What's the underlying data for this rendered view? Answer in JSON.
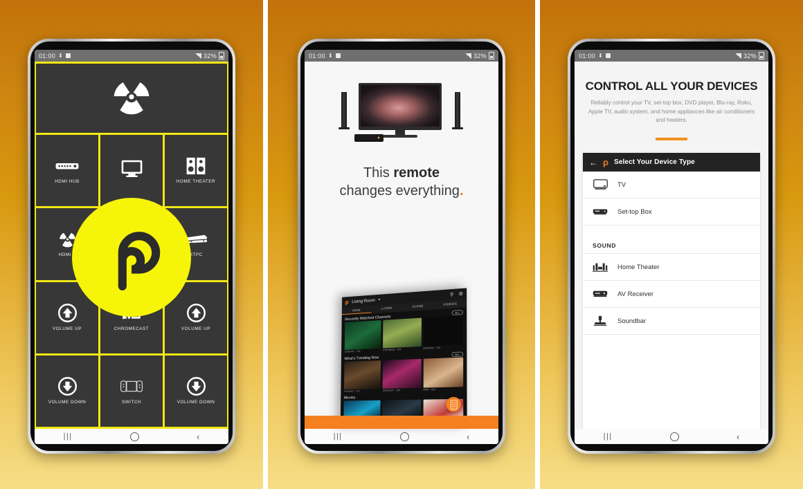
{
  "statusbar": {
    "time": "01:00",
    "battery": "32%",
    "icons": [
      "download-icon",
      "checkbox-icon",
      "signal-icon",
      "battery-icon"
    ]
  },
  "navbar": {
    "recent": "|||",
    "home": "home-circle",
    "back": "‹"
  },
  "panel1": {
    "name": "remote-grid-screen",
    "buttons": [
      {
        "label": "HDMI HUB",
        "icon": "hdmi-hub-icon"
      },
      {
        "label": "",
        "icon": "tv-icon"
      },
      {
        "label": "HOME THEATER",
        "icon": "speakers-icon"
      },
      {
        "label": "HDMI 1",
        "icon": "radiation-icon"
      },
      {
        "label": "",
        "icon": "blank-icon"
      },
      {
        "label": "HTPC",
        "icon": "htpc-icon"
      },
      {
        "label": "VOLUME UP",
        "icon": "volume-up-icon"
      },
      {
        "label": "CHROMECAST",
        "icon": "chromecast-icon"
      },
      {
        "label": "VOLUME UP",
        "icon": "volume-up-icon"
      },
      {
        "label": "VOLUME DOWN",
        "icon": "volume-down-icon"
      },
      {
        "label": "SWITCH",
        "icon": "nintendo-switch-icon"
      },
      {
        "label": "VOLUME DOWN",
        "icon": "volume-down-icon"
      }
    ],
    "hero_icon": "radiation-icon",
    "logo": "peel-p-logo",
    "colors": {
      "accent": "#f2e812",
      "tile": "#373737",
      "logo": "#f6f409"
    }
  },
  "panel2": {
    "name": "remote-promo-screen",
    "headline_line1_plain": "This ",
    "headline_line1_bold": "remote",
    "headline_line2": "changes everything",
    "headline_dot": ".",
    "hero_image": "tv-with-speakers-and-settop-box",
    "app_screenshot": {
      "logo": "peel-p-logo",
      "room": "Living Room",
      "caret": "▾",
      "search_icon": "search-icon",
      "settings_icon": "gear-icon",
      "tabs": [
        "NOW",
        "LATER",
        "GUIDE",
        "VIDEOS"
      ],
      "selected_tab": "NOW",
      "sections": [
        {
          "title": "Recently Watched Channels",
          "all_label": "ALL",
          "captions": [
            "CNBCHD - 762",
            "ESPNNHD - 726",
            "ESPNHD - 724"
          ]
        },
        {
          "title": "What's Trending Now",
          "all_label": "ALL",
          "captions": [
            "FUSEHD - 779",
            "DIGNHDP - 769",
            "INSP - 223"
          ]
        },
        {
          "title": "Movies",
          "all_label": "",
          "captions": []
        }
      ],
      "fab_icon": "remote-control-icon"
    },
    "colors": {
      "accent": "#f4801f",
      "screen_bg": "#f7f7f7"
    }
  },
  "panel3": {
    "name": "device-type-picker-screen",
    "title": "CONTROL ALL YOUR DEVICES",
    "subtitle": "Reliably control your TV, set-top box, DVD player, Blu-ray, Roku, Apple TV, audio system, and home appliances like air conditioners and heaters.",
    "card_header": {
      "back_icon": "arrow-left-icon",
      "logo": "peel-p-logo",
      "title": "Select Your Device Type"
    },
    "rows": [
      {
        "type": "item",
        "label": "TV",
        "icon": "tv-icon"
      },
      {
        "type": "item",
        "label": "Set-top Box",
        "icon": "set-top-box-icon"
      },
      {
        "type": "group",
        "label": "SOUND",
        "icon": ""
      },
      {
        "type": "item",
        "label": "Home Theater",
        "icon": "home-theater-icon"
      },
      {
        "type": "item",
        "label": "AV Receiver",
        "icon": "av-receiver-icon"
      },
      {
        "type": "item",
        "label": "Soundbar",
        "icon": "soundbar-icon"
      }
    ],
    "colors": {
      "accent": "#f2901f",
      "header_bg": "#232323"
    }
  }
}
